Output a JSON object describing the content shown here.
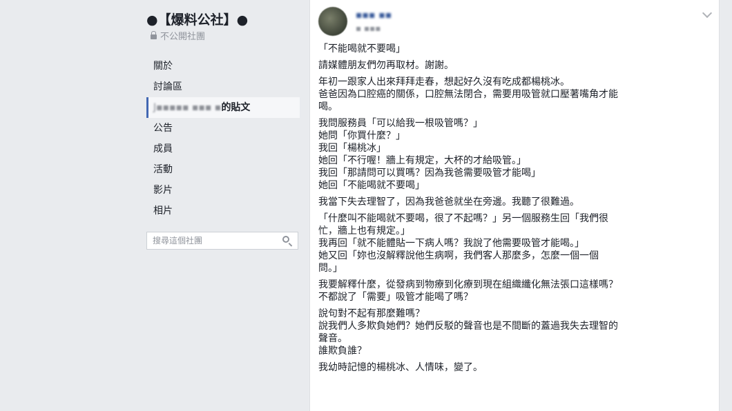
{
  "group": {
    "title": "●【爆料公社】●",
    "privacy": "不公開社團"
  },
  "nav": {
    "items": [
      {
        "label": "關於"
      },
      {
        "label": "討論區"
      },
      {
        "label_blur": "J▪▪▪▪▪ ▪▪▪ ▪",
        "label": "的貼文"
      },
      {
        "label": "公告"
      },
      {
        "label": "成員"
      },
      {
        "label": "活動"
      },
      {
        "label": "影片"
      },
      {
        "label": "相片"
      }
    ]
  },
  "search": {
    "placeholder": "搜尋這個社團"
  },
  "post": {
    "author": "▪▪▪ ▪▪",
    "meta": "▪ ▪▪▪",
    "paragraphs": [
      [
        "「不能喝就不要喝」"
      ],
      [
        "請媒體朋友們勿再取材。謝謝。"
      ],
      [
        "年初一跟家人出來拜拜走春，想起好久沒有吃成都楊桃冰。",
        "爸爸因為口腔癌的關係，口腔無法閉合，需要用吸管就口壓著嘴角才能",
        "喝。"
      ],
      [
        "我問服務員「可以給我一根吸管嗎？」",
        "她問「你買什麼？」",
        "我回「楊桃冰」",
        "她回「不行喔！牆上有規定，大杯的才給吸管。」",
        "我回「那請問可以買嗎？因為我爸需要吸管才能喝」",
        "她回「不能喝就不要喝」"
      ],
      [
        "我當下失去理智了，因為我爸爸就坐在旁邊。我聽了很難過。"
      ],
      [
        "「什麼叫不能喝就不要喝，很了不起嗎？」另一個服務生回「我們很",
        "忙，牆上也有規定。」",
        "我再回「就不能體貼一下病人嗎？我說了他需要吸管才能喝。」",
        "她又回「妳也沒解釋說他生病啊，我們客人那麼多，怎麼一個一個",
        "問。」"
      ],
      [
        "我要解釋什麼，從發病到物療到化療到現在組織纖化無法張口這樣嗎？",
        "不都說了「需要」吸管才能喝了嗎？"
      ],
      [
        "說句對不起有那麼難嗎？",
        "說我們人多欺負她們？她們反駁的聲音也是不間斷的蓋過我失去理智的",
        "聲音。",
        "誰欺負誰？"
      ],
      [
        "我幼時記憶的楊桃冰、人情味，變了。"
      ]
    ]
  }
}
